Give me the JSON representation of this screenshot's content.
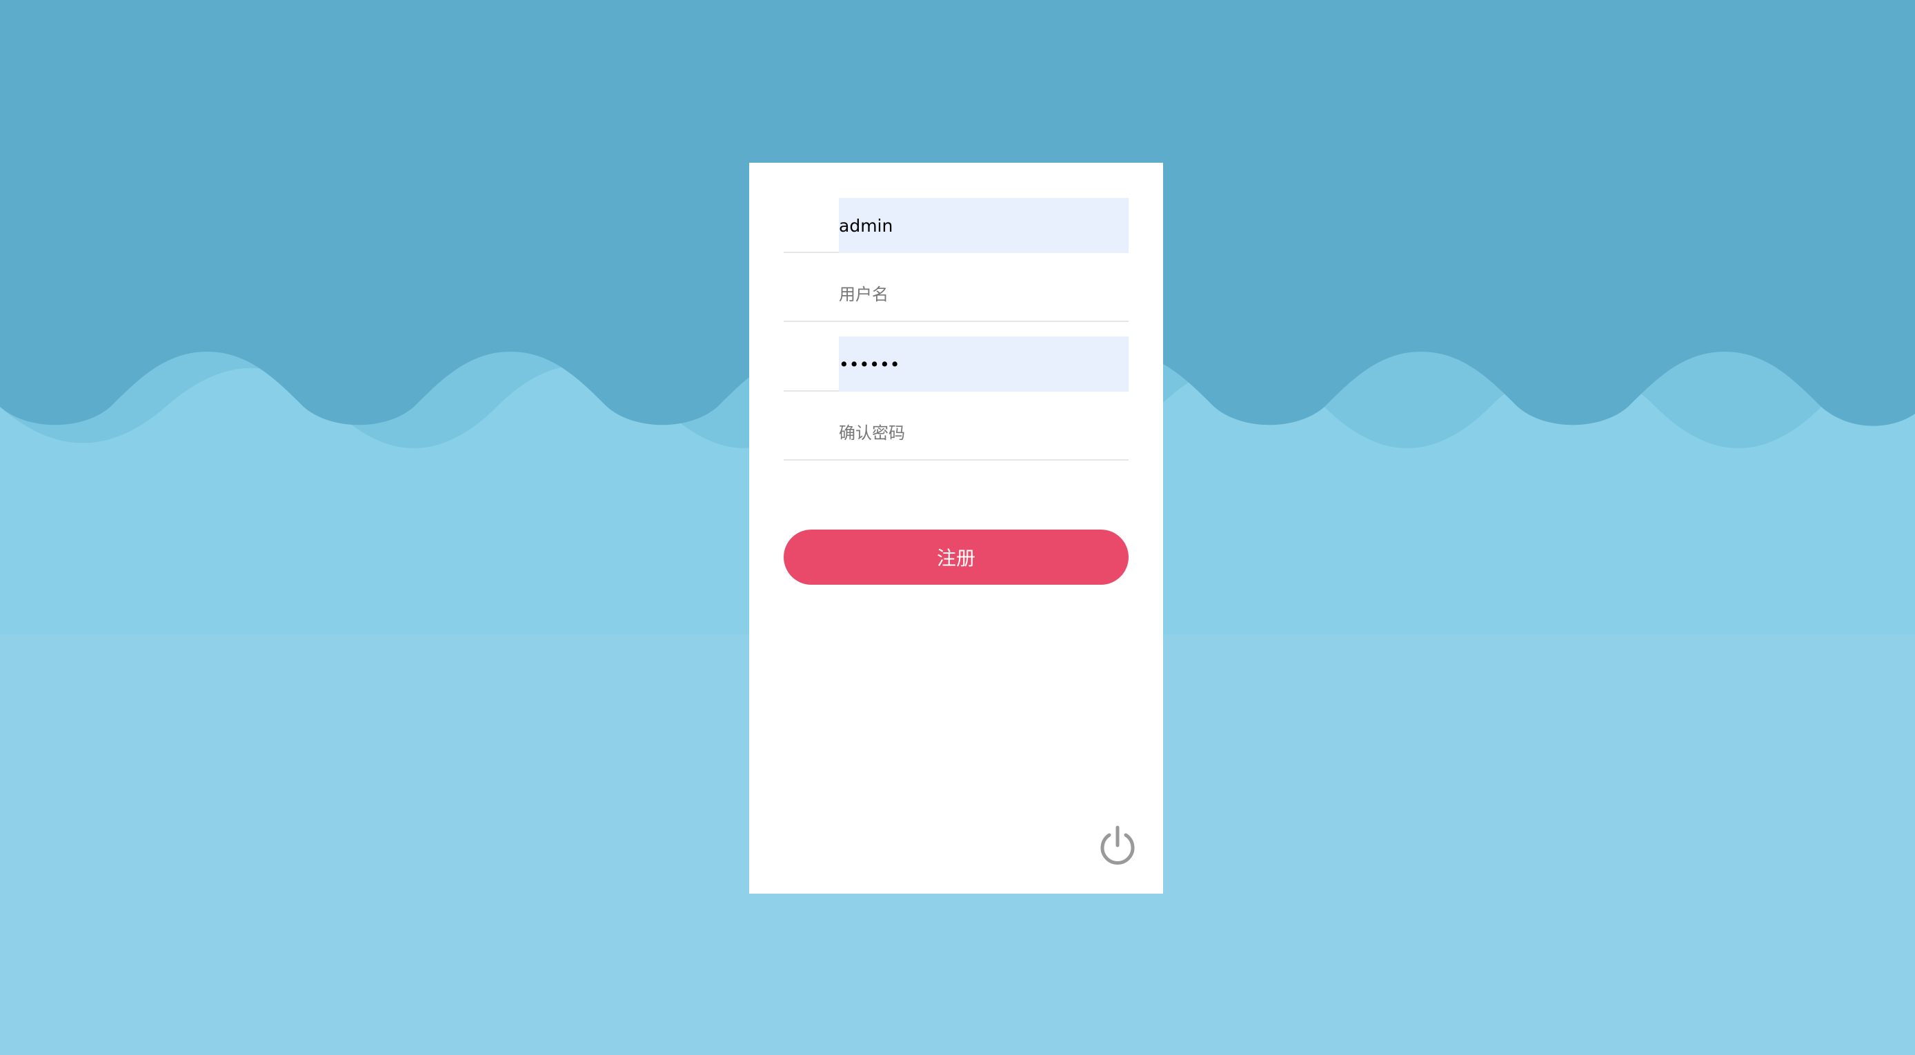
{
  "colors": {
    "background_top": "#5daccb",
    "wave_light": "#79c5e0",
    "background_middle": "#8acfe8",
    "background_bottom": "#90d0e8",
    "button": "#ea4a6a",
    "autofill_bg": "#e8f0fe",
    "icon": "#999999"
  },
  "form": {
    "username_value": "admin",
    "username_placeholder": "用户名",
    "password_value": "••••••",
    "confirm_placeholder": "确认密码",
    "submit_label": "注册"
  },
  "icons": {
    "power": "power-icon"
  }
}
